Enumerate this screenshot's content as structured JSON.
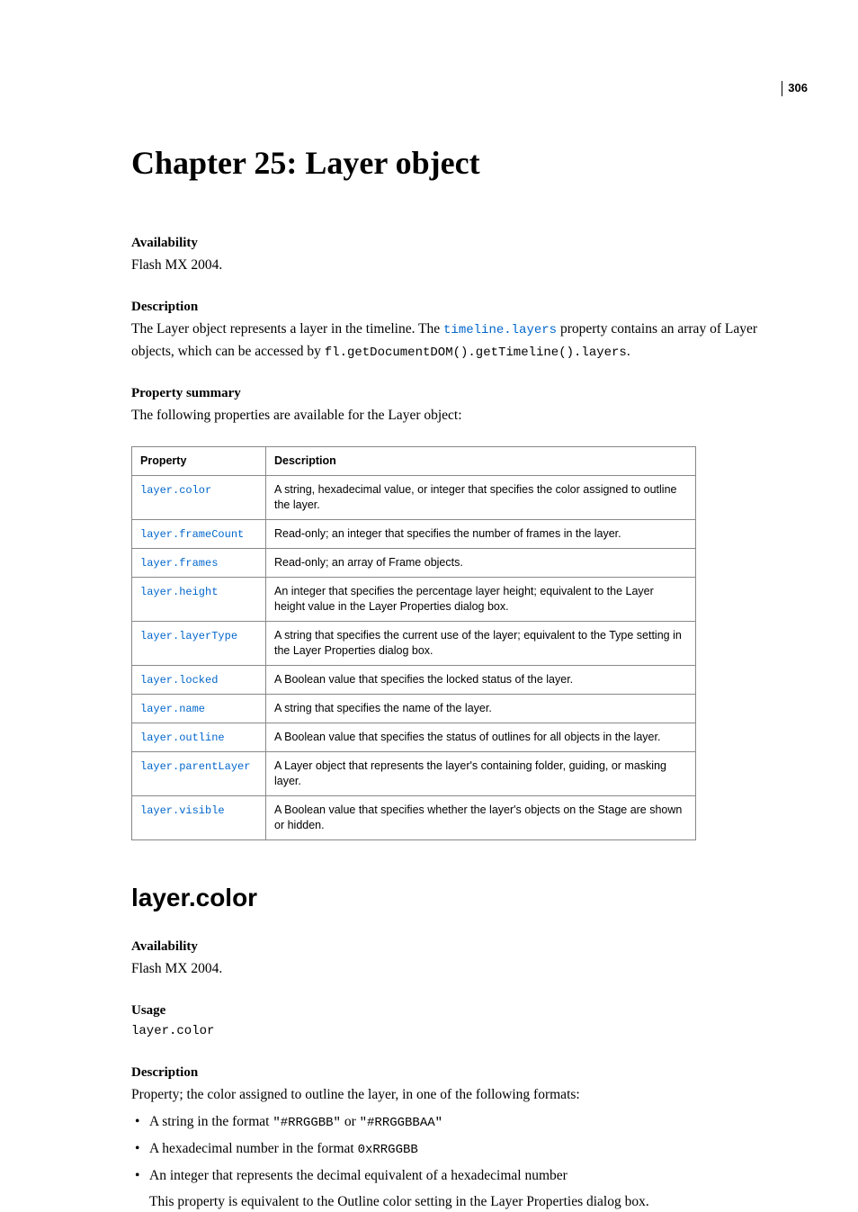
{
  "page_number": "306",
  "chapter_title": "Chapter 25: Layer object",
  "sec1": {
    "availability_label": "Availability",
    "availability_text": "Flash MX 2004.",
    "description_label": "Description",
    "desc_part1": "The Layer object represents a layer in the timeline. The ",
    "desc_link": "timeline.layers",
    "desc_part2": " property contains an array of Layer objects, which can be accessed by ",
    "desc_code": "fl.getDocumentDOM().getTimeline().layers",
    "desc_part3": ".",
    "propsum_label": "Property summary",
    "propsum_text": "The following properties are available for the Layer object:"
  },
  "table": {
    "col_property": "Property",
    "col_description": "Description",
    "rows": [
      {
        "prop": "layer.color",
        "desc": "A string, hexadecimal value, or integer that specifies the color assigned to outline the layer."
      },
      {
        "prop": "layer.frameCount",
        "desc": "Read-only; an integer that specifies the number of frames in the layer."
      },
      {
        "prop": "layer.frames",
        "desc": "Read-only; an array of Frame objects."
      },
      {
        "prop": "layer.height",
        "desc": "An integer that specifies the percentage layer height; equivalent to the Layer height value in the Layer Properties dialog box."
      },
      {
        "prop": "layer.layerType",
        "desc": "A string that specifies the current use of the layer; equivalent to the Type setting in the Layer Properties dialog box."
      },
      {
        "prop": "layer.locked",
        "desc": "A Boolean value that specifies the locked status of the layer."
      },
      {
        "prop": "layer.name",
        "desc": "A string that specifies the name of the layer."
      },
      {
        "prop": "layer.outline",
        "desc": "A Boolean value that specifies the status of outlines for all objects in the layer."
      },
      {
        "prop": "layer.parentLayer",
        "desc": "A Layer object that represents the layer's containing folder, guiding, or masking layer."
      },
      {
        "prop": "layer.visible",
        "desc": "A Boolean value that specifies whether the layer's objects on the Stage are shown or hidden."
      }
    ]
  },
  "api": {
    "heading": "layer.color",
    "availability_label": "Availability",
    "availability_text": "Flash MX 2004.",
    "usage_label": "Usage",
    "usage_code": "layer.color",
    "description_label": "Description",
    "description_text": "Property; the color assigned to outline the layer, in one of the following formats:",
    "bullets": [
      {
        "pre": "A string in the format ",
        "code1": "\"#RRGGBB\"",
        "mid": " or ",
        "code2": "\"#RRGGBBAA\""
      },
      {
        "pre": "A hexadecimal number in the format ",
        "code1": "0xRRGGBB",
        "mid": "",
        "code2": ""
      },
      {
        "pre": "An integer that represents the decimal equivalent of a hexadecimal number",
        "code1": "",
        "mid": "",
        "code2": ""
      }
    ],
    "follow": "This property is equivalent to the Outline color setting in the Layer Properties dialog box."
  }
}
